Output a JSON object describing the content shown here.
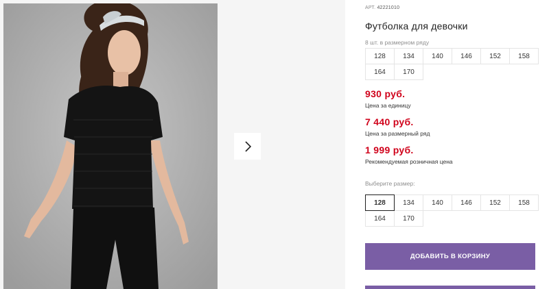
{
  "product": {
    "article_label": "АРТ.",
    "article_number": "42221010",
    "title": "Футболка для девочки"
  },
  "pack_sizes": {
    "note": "8 шт. в размерном ряду",
    "sizes": [
      "128",
      "134",
      "140",
      "146",
      "152",
      "158",
      "164",
      "170"
    ]
  },
  "prices": [
    {
      "value": "930 руб.",
      "label": "Цена за единицу"
    },
    {
      "value": "7 440 руб.",
      "label": "Цена за размерный ряд"
    },
    {
      "value": "1 999 руб.",
      "label": "Рекомендуемая розничная цена"
    }
  ],
  "size_picker": {
    "label": "Выберите размер:",
    "sizes": [
      "128",
      "134",
      "140",
      "146",
      "152",
      "158",
      "164",
      "170"
    ],
    "selected": "128"
  },
  "actions": {
    "add_to_cart": "ДОБАВИТЬ В КОРЗИНУ"
  },
  "colors": {
    "accent": "#7a5ea5",
    "price": "#d0021b"
  },
  "icons": {
    "gallery_next": "chevron-right-icon"
  }
}
